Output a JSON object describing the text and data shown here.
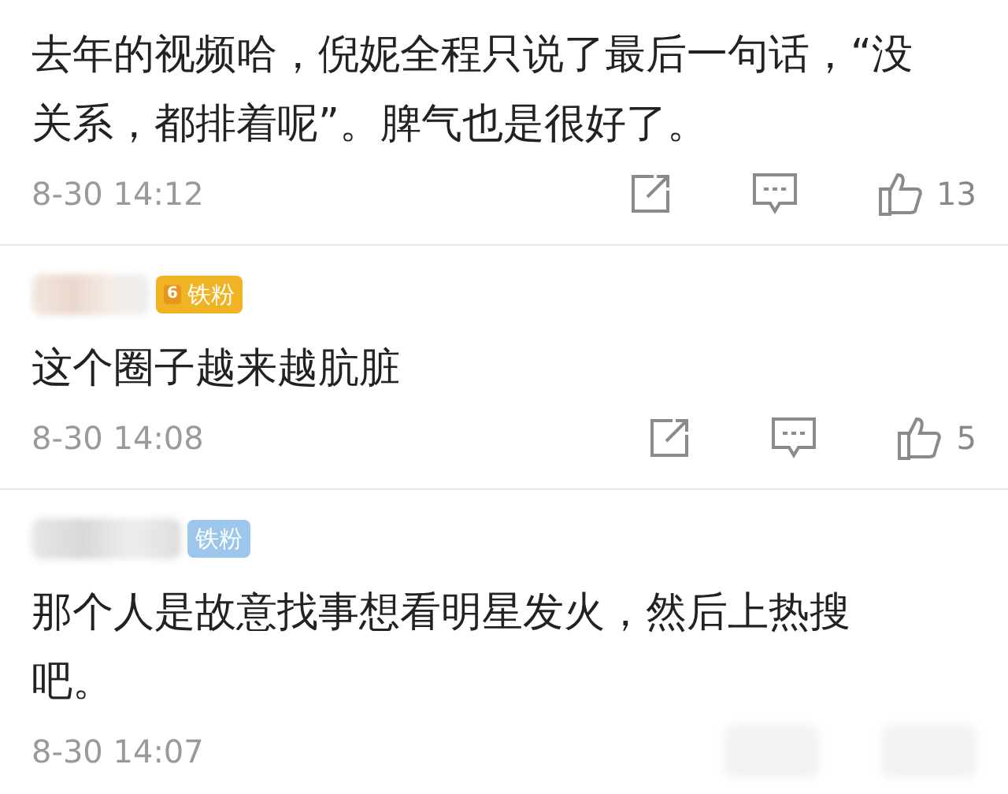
{
  "comments": [
    {
      "name_shown": false,
      "text": "去年的视频哈，倪妮全程只说了最后一句话，“没关系，都排着呢”。脾气也是很好了。",
      "time": "8-30 14:12",
      "actions": true,
      "likes": "13"
    },
    {
      "name_shown": true,
      "badge": {
        "kind": "gold",
        "label": "铁粉",
        "level_text": "6"
      },
      "text": "这个圈子越来越肮脏",
      "time": "8-30 14:08",
      "actions": true,
      "likes": "5"
    },
    {
      "name_shown": true,
      "badge": {
        "kind": "blue",
        "label": "铁粉"
      },
      "text": "那个人是故意找事想看明星发火，然后上热搜吧。",
      "time": "8-30 14:07",
      "actions": false
    }
  ]
}
